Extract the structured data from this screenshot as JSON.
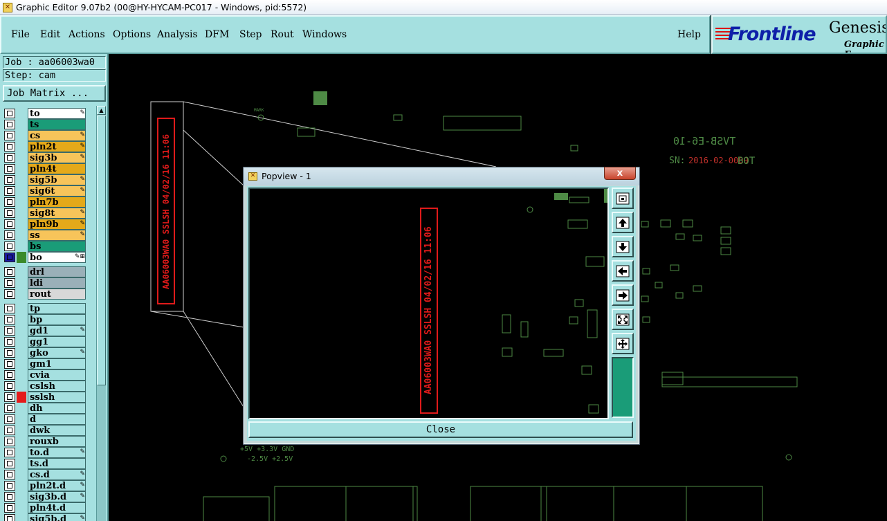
{
  "window": {
    "title": "Graphic Editor 9.07b2 (00@HY-HYCAM-PC017 - Windows, pid:5572)"
  },
  "menu": {
    "items": [
      "File",
      "Edit",
      "Actions",
      "Options",
      "Analysis",
      "DFM",
      "Step",
      "Rout",
      "Windows"
    ],
    "help": "Help"
  },
  "logo": {
    "brand": "Frontline",
    "product": "Genesis",
    "subtitle": "Graphic E"
  },
  "panel": {
    "job": "Job : aa06003wa0",
    "step": "Step: cam",
    "job_matrix": "Job Matrix ..."
  },
  "layers": [
    {
      "name": "to",
      "color": "#ffffff",
      "mark": "✎"
    },
    {
      "name": "ts",
      "color": "#1a9c78",
      "mark": ""
    },
    {
      "name": "cs",
      "color": "#f7c45a",
      "mark": "✎"
    },
    {
      "name": "pln2t",
      "color": "#e4a91a",
      "mark": "✎"
    },
    {
      "name": "sig3b",
      "color": "#f7c45a",
      "mark": "✎"
    },
    {
      "name": "pln4t",
      "color": "#e4a91a",
      "mark": ""
    },
    {
      "name": "sig5b",
      "color": "#f7c45a",
      "mark": "✎"
    },
    {
      "name": "sig6t",
      "color": "#f7c45a",
      "mark": "✎"
    },
    {
      "name": "pln7b",
      "color": "#e4a91a",
      "mark": ""
    },
    {
      "name": "sig8t",
      "color": "#f7c45a",
      "mark": "✎"
    },
    {
      "name": "pln9b",
      "color": "#e4a91a",
      "mark": "✎"
    },
    {
      "name": "ss",
      "color": "#f7c45a",
      "mark": "✎"
    },
    {
      "name": "bs",
      "color": "#1a9c78",
      "mark": ""
    },
    {
      "name": "bo",
      "color": "#ffffff",
      "mark": "✎⊞",
      "swatch": "#3a8a2a",
      "active": true
    },
    {
      "name": "drl",
      "color": "#9ab0b8",
      "mark": ""
    },
    {
      "name": "ldi",
      "color": "#9ab0b8",
      "mark": ""
    },
    {
      "name": "rout",
      "color": "#d8d8d8",
      "mark": ""
    },
    {
      "name": "tp",
      "color": "#a5e0e0",
      "mark": ""
    },
    {
      "name": "bp",
      "color": "#a5e0e0",
      "mark": ""
    },
    {
      "name": "gd1",
      "color": "#a5e0e0",
      "mark": "✎"
    },
    {
      "name": "gg1",
      "color": "#a5e0e0",
      "mark": ""
    },
    {
      "name": "gko",
      "color": "#a5e0e0",
      "mark": "✎"
    },
    {
      "name": "gm1",
      "color": "#a5e0e0",
      "mark": ""
    },
    {
      "name": "cvia",
      "color": "#a5e0e0",
      "mark": ""
    },
    {
      "name": "cslsh",
      "color": "#a5e0e0",
      "mark": ""
    },
    {
      "name": "sslsh",
      "color": "#a5e0e0",
      "mark": "",
      "swatch": "#e51b1b"
    },
    {
      "name": "dh",
      "color": "#a5e0e0",
      "mark": ""
    },
    {
      "name": "d",
      "color": "#a5e0e0",
      "mark": ""
    },
    {
      "name": "dwk",
      "color": "#a5e0e0",
      "mark": ""
    },
    {
      "name": "rouxb",
      "color": "#a5e0e0",
      "mark": ""
    },
    {
      "name": "to.d",
      "color": "#a5e0e0",
      "mark": "✎"
    },
    {
      "name": "ts.d",
      "color": "#a5e0e0",
      "mark": ""
    },
    {
      "name": "cs.d",
      "color": "#a5e0e0",
      "mark": "✎"
    },
    {
      "name": "pln2t.d",
      "color": "#a5e0e0",
      "mark": "✎"
    },
    {
      "name": "sig3b.d",
      "color": "#a5e0e0",
      "mark": "✎"
    },
    {
      "name": "pln4t.d",
      "color": "#a5e0e0",
      "mark": ""
    },
    {
      "name": "sig5b.d",
      "color": "#a5e0e0",
      "mark": "✎"
    }
  ],
  "board": {
    "zoom_label_red": "AA06003WA0 SSLSH 04/02/16 11:06",
    "part_label": "TVSB-E6-10",
    "sn_prefix": "SN:",
    "sn_value": "2016-02-0009",
    "side": "BOT",
    "mark": "MARK",
    "power_labels": "+5V  +3.3V  GND",
    "power_labels2": "-2.5V  +2.5V"
  },
  "popview": {
    "title": "Popview - 1",
    "close_x": "x",
    "close_button": "Close",
    "tools": [
      "zoom-fit-icon",
      "pan-up-icon",
      "pan-down-icon",
      "pan-left-icon",
      "pan-right-icon",
      "zoom-in-icon",
      "zoom-out-icon"
    ]
  }
}
